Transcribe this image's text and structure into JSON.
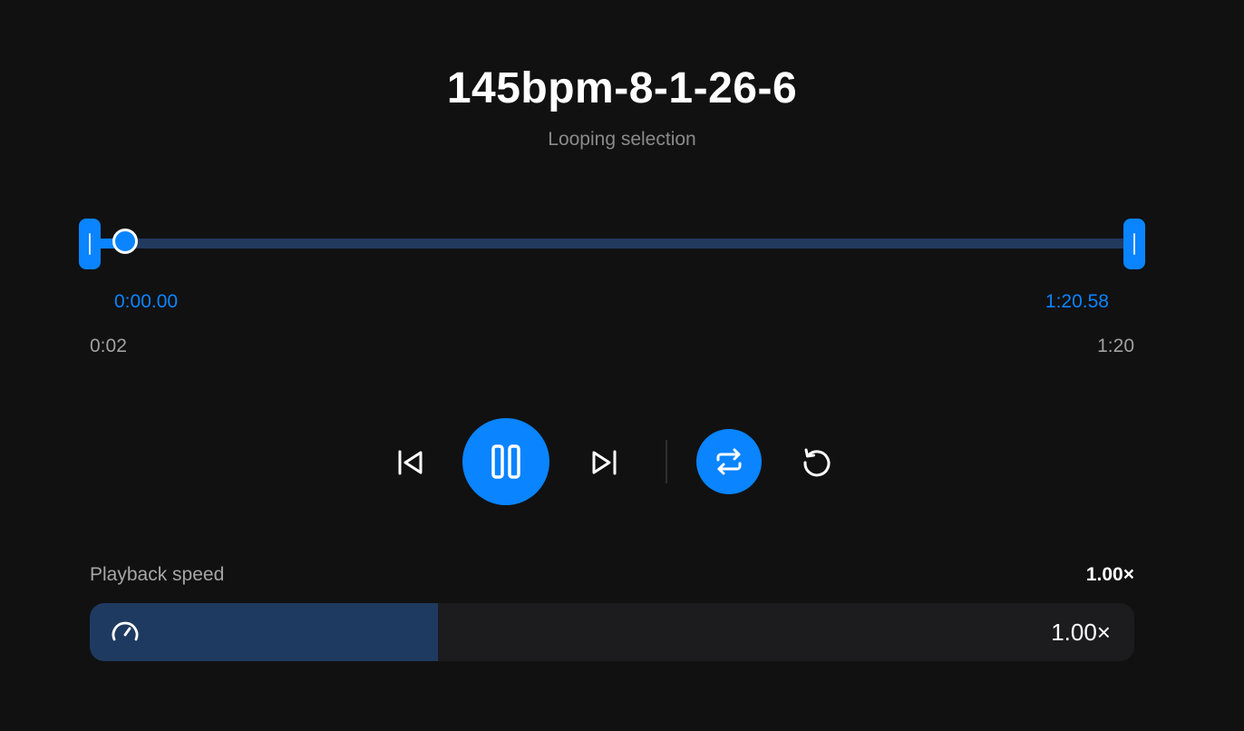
{
  "track": {
    "title": "145bpm-8-1-26-6",
    "status": "Looping selection"
  },
  "timeline": {
    "selection_start": "0:00.00",
    "selection_end": "1:20.58",
    "elapsed": "0:02",
    "total": "1:20",
    "playhead_fraction": 0.025
  },
  "controls": {
    "icons": [
      "skip-back-icon",
      "pause-icon",
      "skip-forward-icon",
      "repeat-icon",
      "reset-icon"
    ],
    "loop_enabled": true
  },
  "speed": {
    "label": "Playback speed",
    "value": "1.00×",
    "bar_value": "1.00×",
    "fill_fraction": 0.333
  },
  "colors": {
    "accent": "#0a84ff",
    "background": "#111111",
    "track": "#223a5e"
  }
}
